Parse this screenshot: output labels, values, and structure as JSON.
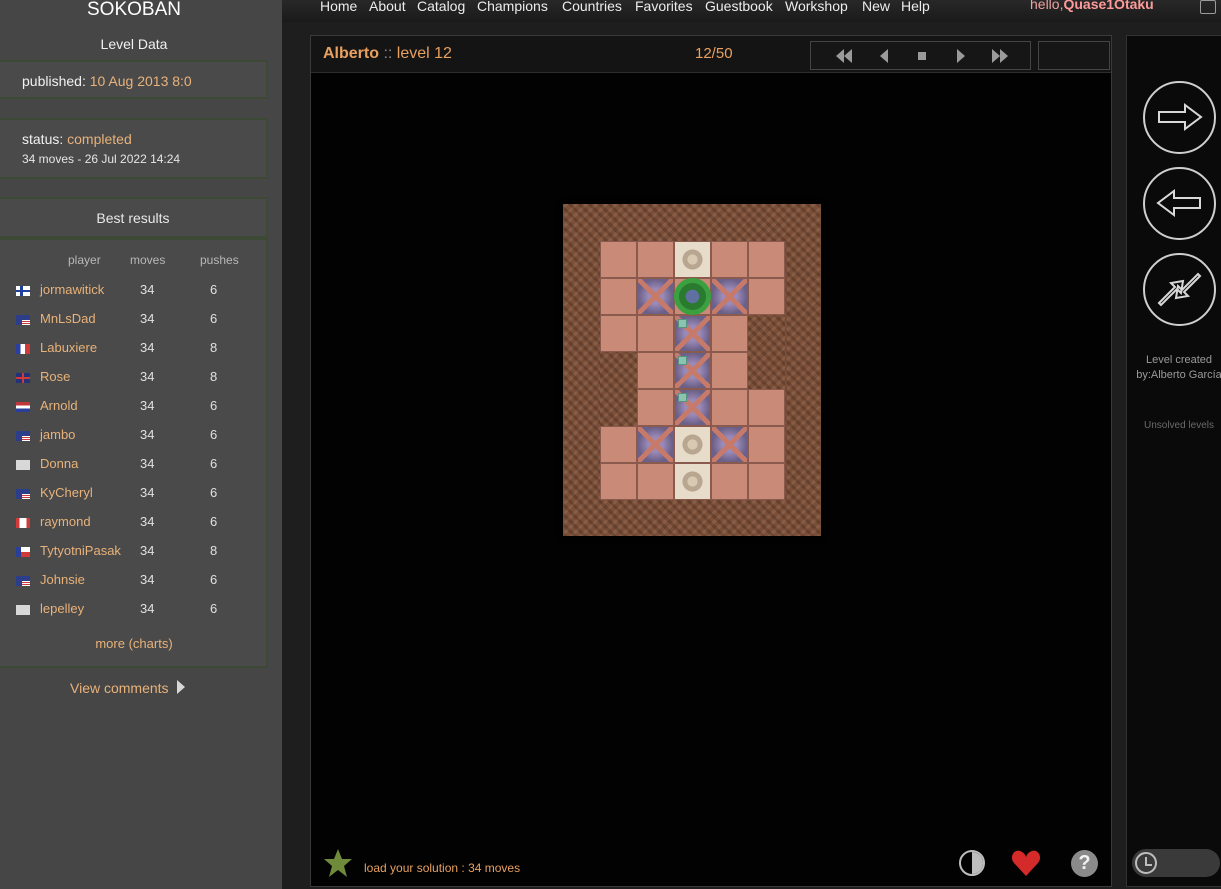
{
  "app": {
    "title": "SOKOBAN"
  },
  "nav": {
    "items": [
      "Home",
      "About",
      "Catalog",
      "Champions",
      "Countries",
      "Favorites",
      "Guestbook",
      "Workshop",
      "New",
      "Help"
    ],
    "greeting": "hello,",
    "username": "Quase1Otaku"
  },
  "level_data": {
    "title": "Level Data",
    "published_label": "published:",
    "published_value": "10 Aug 2013 8:0",
    "status_label": "status:",
    "status_value": "completed",
    "status_detail": "34 moves - 26 Jul 2022 14:24"
  },
  "best_results": {
    "title": "Best results",
    "columns": [
      "player",
      "moves",
      "pushes"
    ],
    "rows": [
      {
        "flag": "fi",
        "player": "jormawitick",
        "moves": "34",
        "pushes": "6"
      },
      {
        "flag": "us",
        "player": "MnLsDad",
        "moves": "34",
        "pushes": "6"
      },
      {
        "flag": "fr",
        "player": "Labuxiere",
        "moves": "34",
        "pushes": "8"
      },
      {
        "flag": "gb",
        "player": "Rose",
        "moves": "34",
        "pushes": "8"
      },
      {
        "flag": "nl",
        "player": "Arnold",
        "moves": "34",
        "pushes": "6"
      },
      {
        "flag": "us",
        "player": "jambo",
        "moves": "34",
        "pushes": "6"
      },
      {
        "flag": "none",
        "player": "Donna",
        "moves": "34",
        "pushes": "6"
      },
      {
        "flag": "us",
        "player": "KyCheryl",
        "moves": "34",
        "pushes": "6"
      },
      {
        "flag": "ca",
        "player": "raymond",
        "moves": "34",
        "pushes": "6"
      },
      {
        "flag": "cz",
        "player": "TytyotniPasak",
        "moves": "34",
        "pushes": "8"
      },
      {
        "flag": "us",
        "player": "Johnsie",
        "moves": "34",
        "pushes": "6"
      },
      {
        "flag": "none",
        "player": "lepelley",
        "moves": "34",
        "pushes": "6"
      }
    ],
    "more_label": "more",
    "charts_label": "(charts)"
  },
  "view_comments": "View comments",
  "game": {
    "author": "Alberto",
    "separator": "::",
    "level_name": "level 12",
    "counter": "12/50",
    "load_solution": "load your solution : 34 moves"
  },
  "right_panel": {
    "created_by": "Level created by:Alberto García",
    "unsolved": "Unsolved levels"
  },
  "colors": {
    "accent": "#e8a060",
    "floor": "#c98a78",
    "wall": "#7a4e37",
    "player": "#3aa040"
  },
  "icons": {
    "controls": [
      "fast-backward-icon",
      "step-back-icon",
      "stop-icon",
      "step-forward-icon",
      "fast-forward-icon"
    ],
    "right": [
      "arrow-right-icon",
      "arrow-left-icon",
      "swap-arrows-icon",
      "clock-icon"
    ]
  }
}
